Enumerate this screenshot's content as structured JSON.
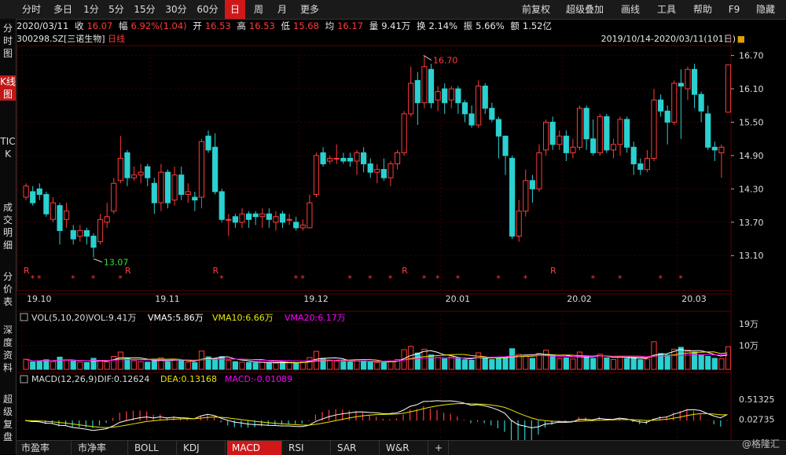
{
  "toolbar": {
    "periods": [
      "分时",
      "多日",
      "1分",
      "5分",
      "15分",
      "30分",
      "60分",
      "日",
      "周",
      "月",
      "更多"
    ],
    "active_period": "日",
    "right_items": [
      "前复权",
      "超级叠加",
      "画线",
      "工具",
      "帮助",
      "F9",
      "隐藏"
    ]
  },
  "left_nav": [
    {
      "label": "分时图",
      "active": false
    },
    {
      "label": "K线图",
      "active": true
    },
    {
      "label": "TICK",
      "active": false
    },
    {
      "label": "成交明细",
      "active": false
    },
    {
      "label": "分价表",
      "active": false
    },
    {
      "label": "深度资料",
      "active": false
    },
    {
      "label": "超级复盘",
      "active": false
    }
  ],
  "info": {
    "date": "2020/03/11",
    "close_label": "收",
    "close": "16.07",
    "change_label": "幅",
    "change": "6.92%(1.04)",
    "open_label": "开",
    "open": "16.53",
    "high_label": "高",
    "high": "16.53",
    "low_label": "低",
    "low": "15.68",
    "avg_label": "均",
    "avg": "16.17",
    "volume_label": "量",
    "volume": "9.41万",
    "turnover_label": "换",
    "turnover": "2.14%",
    "amplitude_label": "振",
    "amplitude": "5.66%",
    "amount_label": "额",
    "amount": "1.52亿"
  },
  "stock": {
    "code": "300298.SZ",
    "name": "[三诺生物]",
    "period": "日线",
    "range": "2019/10/14-2020/03/11(101日)"
  },
  "colors": {
    "up": "#ff3b3b",
    "down": "#2bd0d0",
    "background": "#000000",
    "grid": "#3a0000",
    "vma5": "#ffffff",
    "vma10": "#e8e800",
    "vma20": "#ff00ff"
  },
  "price_axis": {
    "ticks": [
      "16.70",
      "16.10",
      "15.50",
      "14.90",
      "14.30",
      "13.70",
      "13.10"
    ]
  },
  "date_axis": {
    "labels": [
      "19.10",
      "19.11",
      "19.12",
      "20.01",
      "20.02",
      "20.03"
    ]
  },
  "annotations": {
    "high_label": "16.70",
    "low_label": "13.07"
  },
  "markers": {
    "star": "*",
    "r": "R"
  },
  "volume_panel": {
    "title": "VOL(5,10,20)",
    "vol_label": "VOL:9.41万",
    "vma5_label": "VMA5:5.86万",
    "vma10_label": "VMA10:6.66万",
    "vma20_label": "VMA20:6.17万",
    "ticks": [
      "19万",
      "10万"
    ]
  },
  "macd_panel": {
    "title": "MACD(12,26,9)",
    "dif_label": "DIF:0.12624",
    "dea_label": "DEA:0.13168",
    "macd_label": "MACD:-0.01089",
    "ticks": [
      "0.51325",
      "0.02735"
    ]
  },
  "bottom_tabs": [
    "市盈率",
    "市净率",
    "BOLL",
    "KDJ",
    "MACD",
    "RSI",
    "SAR",
    "W&R",
    "+"
  ],
  "active_tab": "MACD",
  "watermark": "@格隆汇",
  "chart_data": {
    "type": "candlestick",
    "price_range": [
      12.75,
      16.85
    ],
    "candles": [
      [
        14.15,
        14.35,
        14.4,
        14.1
      ],
      [
        14.25,
        14.05,
        14.35,
        14.0
      ],
      [
        14.3,
        14.2,
        14.4,
        14.1
      ],
      [
        14.2,
        13.85,
        14.25,
        13.8
      ],
      [
        13.75,
        14.05,
        14.15,
        13.7
      ],
      [
        14.0,
        13.55,
        14.05,
        13.3
      ],
      [
        13.75,
        13.9,
        14.05,
        13.6
      ],
      [
        13.55,
        13.4,
        13.65,
        13.3
      ],
      [
        13.45,
        13.55,
        13.65,
        13.35
      ],
      [
        13.55,
        13.45,
        13.6,
        13.3
      ],
      [
        13.45,
        13.25,
        13.5,
        13.07
      ],
      [
        13.35,
        13.75,
        13.85,
        13.3
      ],
      [
        13.7,
        13.8,
        14.05,
        13.6
      ],
      [
        13.9,
        14.4,
        14.5,
        13.85
      ],
      [
        14.45,
        14.85,
        15.25,
        14.4
      ],
      [
        14.95,
        14.5,
        15.0,
        14.35
      ],
      [
        14.5,
        14.55,
        14.7,
        14.45
      ],
      [
        14.55,
        14.6,
        14.75,
        14.4
      ],
      [
        14.7,
        14.5,
        14.75,
        14.35
      ],
      [
        14.4,
        14.05,
        14.5,
        13.85
      ],
      [
        14.05,
        14.6,
        14.75,
        13.9
      ],
      [
        14.6,
        14.05,
        14.65,
        13.95
      ],
      [
        14.1,
        14.55,
        14.7,
        14.0
      ],
      [
        14.55,
        14.2,
        14.7,
        14.1
      ],
      [
        14.2,
        14.25,
        14.4,
        14.05
      ],
      [
        14.15,
        14.1,
        14.25,
        13.9
      ],
      [
        14.15,
        15.15,
        15.2,
        13.95
      ],
      [
        15.25,
        15.0,
        15.35,
        14.95
      ],
      [
        15.05,
        14.25,
        15.3,
        14.2
      ],
      [
        14.25,
        13.75,
        14.3,
        13.7
      ],
      [
        13.75,
        13.75,
        13.85,
        13.45
      ],
      [
        13.8,
        13.7,
        13.85,
        13.6
      ],
      [
        13.7,
        13.85,
        13.95,
        13.6
      ],
      [
        13.85,
        13.75,
        13.9,
        13.6
      ],
      [
        13.85,
        13.8,
        13.9,
        13.65
      ],
      [
        13.8,
        13.85,
        13.95,
        13.6
      ],
      [
        13.85,
        13.75,
        13.95,
        13.6
      ],
      [
        13.7,
        13.8,
        13.9,
        13.55
      ],
      [
        13.85,
        13.7,
        13.9,
        13.6
      ],
      [
        13.75,
        13.75,
        13.85,
        13.65
      ],
      [
        13.7,
        13.6,
        13.8,
        13.55
      ],
      [
        13.6,
        13.65,
        13.75,
        13.55
      ],
      [
        13.6,
        14.05,
        14.2,
        13.6
      ],
      [
        14.2,
        14.9,
        14.95,
        14.15
      ],
      [
        14.95,
        14.75,
        15.05,
        14.7
      ],
      [
        14.8,
        14.85,
        14.9,
        14.75
      ],
      [
        14.85,
        14.85,
        15.1,
        14.75
      ],
      [
        14.85,
        14.8,
        14.95,
        14.75
      ],
      [
        14.85,
        14.8,
        14.95,
        14.7
      ],
      [
        14.8,
        14.95,
        15.0,
        14.55
      ],
      [
        14.95,
        14.75,
        15.05,
        14.6
      ],
      [
        14.75,
        14.6,
        14.85,
        14.5
      ],
      [
        14.6,
        14.65,
        14.75,
        14.4
      ],
      [
        14.65,
        14.5,
        14.85,
        14.45
      ],
      [
        14.5,
        14.75,
        14.8,
        14.35
      ],
      [
        14.75,
        14.95,
        15.0,
        14.65
      ],
      [
        14.95,
        15.65,
        15.7,
        14.9
      ],
      [
        15.65,
        16.2,
        16.5,
        15.6
      ],
      [
        16.25,
        15.85,
        16.4,
        15.45
      ],
      [
        15.85,
        16.5,
        16.7,
        15.75
      ],
      [
        16.45,
        15.85,
        16.55,
        15.75
      ],
      [
        15.9,
        16.05,
        16.15,
        15.7
      ],
      [
        16.1,
        15.85,
        16.2,
        15.65
      ],
      [
        15.9,
        16.1,
        16.15,
        15.75
      ],
      [
        16.1,
        15.85,
        16.15,
        15.65
      ],
      [
        15.85,
        15.65,
        15.9,
        15.5
      ],
      [
        15.65,
        15.45,
        15.8,
        15.4
      ],
      [
        15.45,
        16.15,
        16.25,
        15.4
      ],
      [
        16.15,
        15.75,
        16.2,
        15.65
      ],
      [
        15.75,
        15.55,
        15.85,
        15.5
      ],
      [
        15.55,
        15.25,
        15.6,
        14.85
      ],
      [
        15.25,
        14.9,
        15.25,
        14.55
      ],
      [
        14.85,
        13.45,
        14.9,
        13.4
      ],
      [
        13.45,
        13.9,
        14.1,
        13.35
      ],
      [
        13.9,
        14.45,
        14.65,
        13.8
      ],
      [
        14.45,
        14.3,
        14.55,
        14.05
      ],
      [
        14.3,
        14.95,
        15.1,
        14.25
      ],
      [
        15.0,
        15.5,
        15.55,
        14.9
      ],
      [
        15.5,
        15.1,
        15.6,
        15.0
      ],
      [
        15.1,
        15.25,
        15.35,
        15.0
      ],
      [
        15.25,
        14.95,
        15.35,
        14.8
      ],
      [
        14.95,
        15.05,
        15.2,
        14.85
      ],
      [
        15.05,
        15.75,
        15.8,
        15.0
      ],
      [
        15.75,
        15.2,
        15.8,
        15.0
      ],
      [
        15.2,
        14.95,
        15.55,
        14.9
      ],
      [
        14.95,
        15.6,
        15.65,
        14.9
      ],
      [
        15.6,
        15.0,
        15.65,
        14.95
      ],
      [
        15.0,
        15.1,
        15.2,
        14.85
      ],
      [
        15.1,
        15.55,
        15.6,
        14.9
      ],
      [
        15.55,
        15.05,
        15.6,
        14.95
      ],
      [
        15.05,
        14.75,
        15.15,
        14.55
      ],
      [
        14.75,
        14.65,
        14.85,
        14.55
      ],
      [
        14.65,
        14.85,
        15.0,
        14.6
      ],
      [
        14.85,
        15.9,
        16.1,
        14.8
      ],
      [
        15.9,
        15.7,
        16.0,
        15.6
      ],
      [
        15.7,
        15.5,
        15.8,
        15.1
      ],
      [
        15.5,
        16.2,
        16.25,
        15.45
      ],
      [
        16.2,
        16.15,
        16.45,
        15.2
      ],
      [
        16.1,
        16.45,
        16.5,
        15.9
      ],
      [
        16.45,
        16.0,
        16.55,
        15.75
      ],
      [
        16.0,
        15.7,
        16.05,
        15.5
      ],
      [
        15.65,
        15.05,
        15.8,
        15.0
      ],
      [
        15.05,
        15.0,
        15.15,
        14.8
      ],
      [
        14.95,
        15.05,
        15.1,
        14.5
      ],
      [
        15.68,
        16.53,
        16.53,
        15.68
      ]
    ],
    "volume": [
      4.2,
      3.1,
      3.5,
      4.0,
      3.2,
      5.1,
      3.8,
      3.4,
      3.0,
      2.9,
      4.6,
      3.7,
      3.1,
      5.4,
      7.2,
      4.6,
      3.6,
      3.2,
      3.0,
      4.1,
      4.8,
      3.2,
      3.9,
      3.6,
      3.0,
      2.8,
      7.6,
      5.2,
      4.4,
      5.3,
      3.8,
      3.2,
      3.0,
      2.9,
      2.7,
      3.0,
      2.8,
      2.6,
      2.9,
      2.7,
      2.8,
      3.0,
      4.9,
      7.5,
      4.6,
      3.6,
      3.4,
      3.2,
      3.1,
      4.0,
      3.6,
      3.0,
      2.9,
      2.8,
      3.5,
      4.1,
      8.2,
      9.6,
      6.8,
      8.4,
      6.0,
      5.0,
      4.4,
      5.2,
      4.6,
      4.0,
      3.8,
      6.9,
      5.0,
      4.1,
      4.5,
      5.0,
      8.6,
      6.2,
      5.8,
      4.6,
      6.6,
      8.0,
      5.6,
      4.4,
      4.8,
      4.3,
      7.2,
      5.4,
      4.6,
      6.3,
      4.8,
      4.1,
      5.5,
      4.6,
      4.8,
      4.0,
      4.3,
      11.5,
      6.6,
      6.0,
      8.4,
      9.2,
      8.0,
      7.2,
      6.0,
      5.4,
      4.6,
      4.4,
      9.41
    ]
  }
}
